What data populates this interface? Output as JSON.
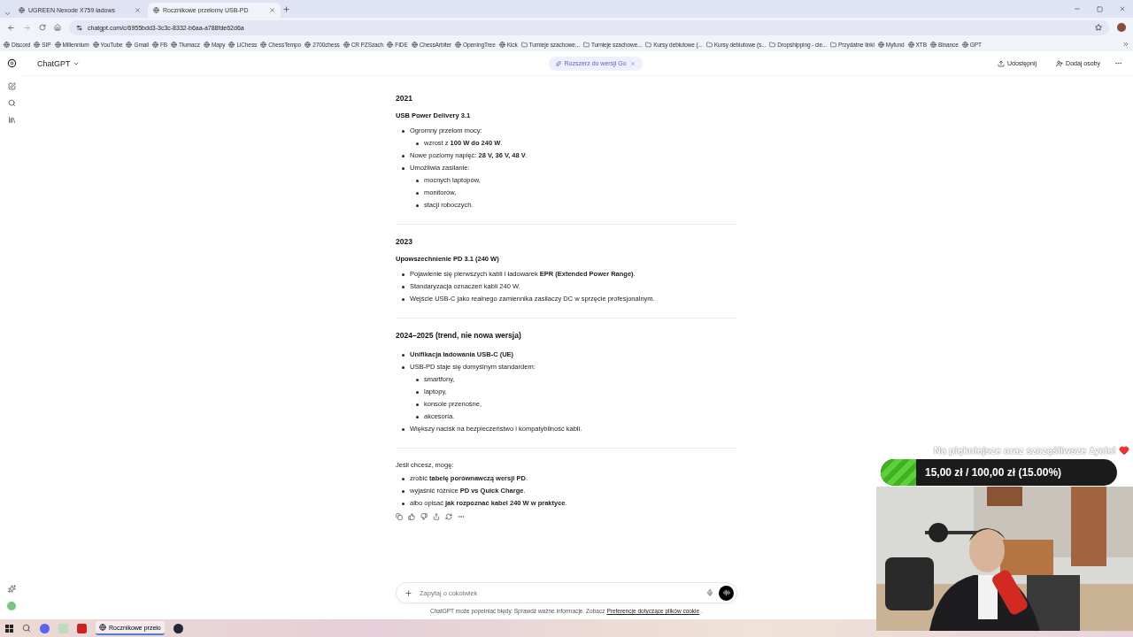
{
  "browser": {
    "tabs": [
      {
        "title": "UGREEN Nexode X759 ładows",
        "selected": false
      },
      {
        "title": "Rocznikowe przełomy USB-PD",
        "selected": true
      }
    ],
    "address": "chatgpt.com/c/6955bdd3-3c3c-8332-b6aa-a788fde62d6a",
    "bookmarks": [
      {
        "label": "Discord",
        "kind": "site"
      },
      {
        "label": "SIP",
        "kind": "site"
      },
      {
        "label": "Millennium",
        "kind": "site"
      },
      {
        "label": "YouTube",
        "kind": "site"
      },
      {
        "label": "Gmail",
        "kind": "site"
      },
      {
        "label": "FB",
        "kind": "site"
      },
      {
        "label": "Tłumacz",
        "kind": "site"
      },
      {
        "label": "Mapy",
        "kind": "site"
      },
      {
        "label": "LiChess",
        "kind": "site"
      },
      {
        "label": "ChessTempo",
        "kind": "site"
      },
      {
        "label": "2700chess",
        "kind": "site"
      },
      {
        "label": "CR PZSzach",
        "kind": "site"
      },
      {
        "label": "FIDE",
        "kind": "site"
      },
      {
        "label": "ChessArbiter",
        "kind": "site"
      },
      {
        "label": "OpeningTree",
        "kind": "site"
      },
      {
        "label": "Kick",
        "kind": "site"
      },
      {
        "label": "Turnieje szachowe...",
        "kind": "folder"
      },
      {
        "label": "Turnieje szachowe...",
        "kind": "folder"
      },
      {
        "label": "Kursy debiutowe (...",
        "kind": "folder"
      },
      {
        "label": "Kursy debiutowe (s...",
        "kind": "folder"
      },
      {
        "label": "Dropshipping - cie...",
        "kind": "folder"
      },
      {
        "label": "Przydatne linki",
        "kind": "folder"
      },
      {
        "label": "Myfund",
        "kind": "site"
      },
      {
        "label": "XTB",
        "kind": "site"
      },
      {
        "label": "Binance",
        "kind": "site"
      },
      {
        "label": "GPT",
        "kind": "site"
      }
    ]
  },
  "app": {
    "title": "ChatGPT",
    "upgrade": "Rozszerz do wersji Go",
    "actions": [
      "Udostępnij",
      "Dodaj osoby"
    ]
  },
  "sections": [
    {
      "heading": "2021",
      "subheading": "USB Power Delivery 3.1",
      "items": [
        {
          "text": "Ogromny przełom mocy:",
          "children": [
            {
              "text": "wzrost z **100 W do 240 W**."
            }
          ]
        },
        {
          "text": "Nowe poziomy napięć: **28 V, 36 V, 48 V**."
        },
        {
          "text": "Umożliwia zasilanie:",
          "children": [
            {
              "text": "mocnych laptopów,"
            },
            {
              "text": "monitorów,"
            },
            {
              "text": "stacji roboczych."
            }
          ]
        }
      ]
    },
    {
      "heading": "2023",
      "subheading": "Upowszechnienie PD 3.1 (240 W)",
      "items": [
        {
          "text": "Pojawienie się pierwszych kabli i ładowarek **EPR (Extended Power Range)**."
        },
        {
          "text": "Standaryzacja oznaczeń kabli 240 W."
        },
        {
          "text": "Wejście USB-C jako realnego zamiennika zasilaczy DC w sprzęcie profesjonalnym."
        }
      ]
    },
    {
      "heading": "2024–2025 (trend, nie nowa wersja)",
      "items": [
        {
          "text": "Unifikacja ładowania USB-C (UE)",
          "bold": true
        },
        {
          "text": "USB-PD staje się domyślnym standardem:",
          "children": [
            {
              "text": "smartfony,"
            },
            {
              "text": "laptopy,"
            },
            {
              "text": "konsole przenośne,"
            },
            {
              "text": "akcesoria."
            }
          ]
        },
        {
          "text": "Większy nacisk na bezpieczeństwo i kompatybilność kabli."
        }
      ]
    }
  ],
  "closing": {
    "intro": "Jeśli chcesz, mogę:",
    "items": [
      {
        "text": "zrobić **tabelę porównawczą wersji PD**."
      },
      {
        "text": "wyjaśnić różnice **PD vs Quick Charge**."
      },
      {
        "text": "albo opisać **jak rozpoznać kabel 240 W w praktyce**."
      }
    ]
  },
  "composer": {
    "placeholder": "Zapytaj o cokolwiek"
  },
  "disclaimer": {
    "text": "ChatGPT może popełniać błędy. Sprawdź ważne informacje. Zobacz",
    "link": "Preferencje dotyczące plików cookie",
    "end": "."
  },
  "overlay": {
    "goal_title": "Na piękniejsze oraz szczęśliwsze życie!",
    "goal_label": "15,00 zł / 100,00 zł (15.00%)",
    "level": 0.15
  },
  "taskbar": {
    "items": [
      {
        "label": "Rocznikowe przeło"
      }
    ]
  }
}
